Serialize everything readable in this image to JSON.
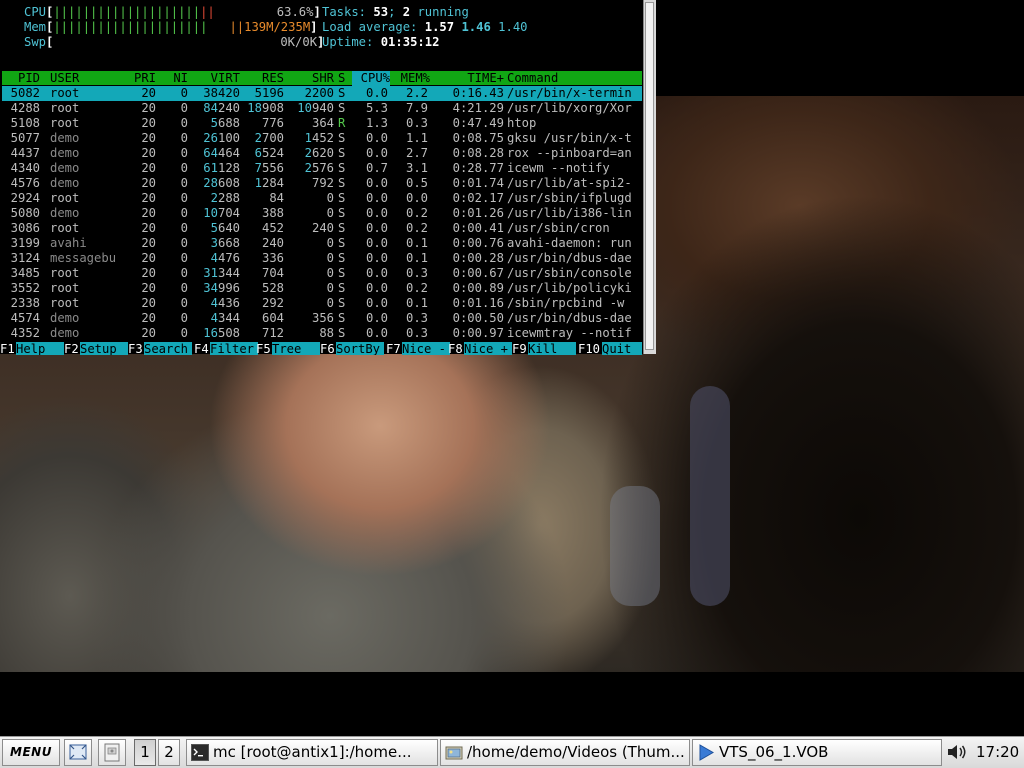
{
  "htop": {
    "meters": {
      "cpu": {
        "label": "CPU",
        "value": "63.6%",
        "bar_green": "||||||||||||||||||||",
        "bar_red": "||"
      },
      "mem": {
        "label": "Mem",
        "value": "139M/235M",
        "bar_green": "|||||||||||||||||||||",
        "bar_orange": "||"
      },
      "swp": {
        "label": "Swp",
        "value": "0K/0K"
      }
    },
    "tasks": {
      "label": "Tasks:",
      "count": "53",
      "sep": ";",
      "running": "2",
      "running_label": "running"
    },
    "load": {
      "label": "Load average:",
      "v1": "1.57",
      "v2": "1.46",
      "v3": "1.40"
    },
    "uptime": {
      "label": "Uptime:",
      "value": "01:35:12"
    },
    "columns": [
      "PID",
      "USER",
      "PRI",
      "NI",
      "VIRT",
      "RES",
      "SHR",
      "S",
      "CPU%",
      "MEM%",
      "TIME+",
      "Command"
    ],
    "rows": [
      {
        "pid": "5082",
        "user": "root",
        "pri": "20",
        "ni": "0",
        "virt": "38420",
        "res": "5196",
        "shr": "2200",
        "s": "S",
        "cpu": "0.0",
        "mem": "2.2",
        "time": "0:16.43",
        "cmd": "/usr/bin/x-termin"
      },
      {
        "pid": "4288",
        "user": "root",
        "pri": "20",
        "ni": "0",
        "virt": "84240",
        "res": "18908",
        "shr": "10940",
        "s": "S",
        "cpu": "5.3",
        "mem": "7.9",
        "time": "4:21.29",
        "cmd": "/usr/lib/xorg/Xor"
      },
      {
        "pid": "5108",
        "user": "root",
        "pri": "20",
        "ni": "0",
        "virt": "5688",
        "res": "776",
        "shr": "364",
        "s": "R",
        "cpu": "1.3",
        "mem": "0.3",
        "time": "0:47.49",
        "cmd": "htop"
      },
      {
        "pid": "5077",
        "user": "demo",
        "pri": "20",
        "ni": "0",
        "virt": "26100",
        "res": "2700",
        "shr": "1452",
        "s": "S",
        "cpu": "0.0",
        "mem": "1.1",
        "time": "0:08.75",
        "cmd": "gksu /usr/bin/x-t"
      },
      {
        "pid": "4437",
        "user": "demo",
        "pri": "20",
        "ni": "0",
        "virt": "64464",
        "res": "6524",
        "shr": "2620",
        "s": "S",
        "cpu": "0.0",
        "mem": "2.7",
        "time": "0:08.28",
        "cmd": "rox --pinboard=an"
      },
      {
        "pid": "4340",
        "user": "demo",
        "pri": "20",
        "ni": "0",
        "virt": "61128",
        "res": "7556",
        "shr": "2576",
        "s": "S",
        "cpu": "0.7",
        "mem": "3.1",
        "time": "0:28.77",
        "cmd": "icewm --notify"
      },
      {
        "pid": "4576",
        "user": "demo",
        "pri": "20",
        "ni": "0",
        "virt": "28608",
        "res": "1284",
        "shr": "792",
        "s": "S",
        "cpu": "0.0",
        "mem": "0.5",
        "time": "0:01.74",
        "cmd": "/usr/lib/at-spi2-"
      },
      {
        "pid": "2924",
        "user": "root",
        "pri": "20",
        "ni": "0",
        "virt": "2288",
        "res": "84",
        "shr": "0",
        "s": "S",
        "cpu": "0.0",
        "mem": "0.0",
        "time": "0:02.17",
        "cmd": "/usr/sbin/ifplugd"
      },
      {
        "pid": "5080",
        "user": "demo",
        "pri": "20",
        "ni": "0",
        "virt": "10704",
        "res": "388",
        "shr": "0",
        "s": "S",
        "cpu": "0.0",
        "mem": "0.2",
        "time": "0:01.26",
        "cmd": "/usr/lib/i386-lin"
      },
      {
        "pid": "3086",
        "user": "root",
        "pri": "20",
        "ni": "0",
        "virt": "5640",
        "res": "452",
        "shr": "240",
        "s": "S",
        "cpu": "0.0",
        "mem": "0.2",
        "time": "0:00.41",
        "cmd": "/usr/sbin/cron"
      },
      {
        "pid": "3199",
        "user": "avahi",
        "pri": "20",
        "ni": "0",
        "virt": "3668",
        "res": "240",
        "shr": "0",
        "s": "S",
        "cpu": "0.0",
        "mem": "0.1",
        "time": "0:00.76",
        "cmd": "avahi-daemon: run"
      },
      {
        "pid": "3124",
        "user": "messagebu",
        "pri": "20",
        "ni": "0",
        "virt": "4476",
        "res": "336",
        "shr": "0",
        "s": "S",
        "cpu": "0.0",
        "mem": "0.1",
        "time": "0:00.28",
        "cmd": "/usr/bin/dbus-dae"
      },
      {
        "pid": "3485",
        "user": "root",
        "pri": "20",
        "ni": "0",
        "virt": "31344",
        "res": "704",
        "shr": "0",
        "s": "S",
        "cpu": "0.0",
        "mem": "0.3",
        "time": "0:00.67",
        "cmd": "/usr/sbin/console"
      },
      {
        "pid": "3552",
        "user": "root",
        "pri": "20",
        "ni": "0",
        "virt": "34996",
        "res": "528",
        "shr": "0",
        "s": "S",
        "cpu": "0.0",
        "mem": "0.2",
        "time": "0:00.89",
        "cmd": "/usr/lib/policyki"
      },
      {
        "pid": "2338",
        "user": "root",
        "pri": "20",
        "ni": "0",
        "virt": "4436",
        "res": "292",
        "shr": "0",
        "s": "S",
        "cpu": "0.0",
        "mem": "0.1",
        "time": "0:01.16",
        "cmd": "/sbin/rpcbind -w"
      },
      {
        "pid": "4574",
        "user": "demo",
        "pri": "20",
        "ni": "0",
        "virt": "4344",
        "res": "604",
        "shr": "356",
        "s": "S",
        "cpu": "0.0",
        "mem": "0.3",
        "time": "0:00.50",
        "cmd": "/usr/bin/dbus-dae"
      },
      {
        "pid": "4352",
        "user": "demo",
        "pri": "20",
        "ni": "0",
        "virt": "16508",
        "res": "712",
        "shr": "88",
        "s": "S",
        "cpu": "0.0",
        "mem": "0.3",
        "time": "0:00.97",
        "cmd": "icewmtray --notif"
      }
    ],
    "fkeys": [
      {
        "key": "F1",
        "label": "Help"
      },
      {
        "key": "F2",
        "label": "Setup"
      },
      {
        "key": "F3",
        "label": "Search"
      },
      {
        "key": "F4",
        "label": "Filter"
      },
      {
        "key": "F5",
        "label": "Tree"
      },
      {
        "key": "F6",
        "label": "SortBy"
      },
      {
        "key": "F7",
        "label": "Nice -"
      },
      {
        "key": "F8",
        "label": "Nice +"
      },
      {
        "key": "F9",
        "label": "Kill"
      },
      {
        "key": "F10",
        "label": "Quit"
      }
    ]
  },
  "taskbar": {
    "menu_label": "MENU",
    "workspaces": [
      "1",
      "2"
    ],
    "tasks": [
      {
        "title": "mc [root@antix1]:/home...",
        "icon": "terminal-icon"
      },
      {
        "title": "/home/demo/Videos (Thum...",
        "icon": "file-manager-icon"
      },
      {
        "title": "VTS_06_1.VOB",
        "icon": "media-player-icon"
      }
    ],
    "clock": "17:20"
  },
  "colors": {
    "selection": "#13a8b8",
    "header": "#11a614",
    "cyan": "#4fc3d5",
    "green": "#54c84c",
    "red": "#e14a36",
    "orange": "#e88b2c"
  }
}
